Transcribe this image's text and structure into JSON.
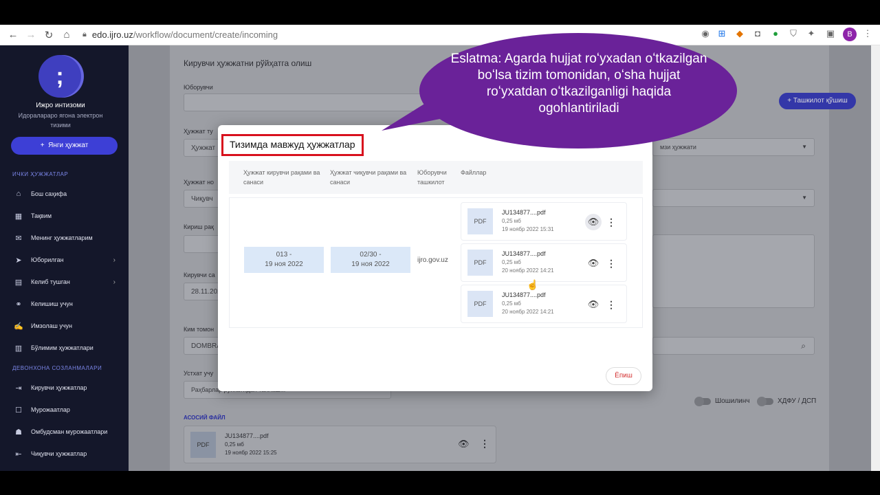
{
  "browser": {
    "url_host": "edo.ijro.uz",
    "url_path": "/workflow/document/create/incoming",
    "profile_initial": "B"
  },
  "sidebar": {
    "org_name": "Ижро интизоми",
    "org_subtitle": "Идоралараро ягона электрон тизими",
    "new_doc_button": "Янги ҳужжат",
    "section_internal": "ИЧКИ ҲУЖЖАТЛАР",
    "section_office": "ДЕВОНХОНА СОЗЛАНМАЛАРИ",
    "items": [
      {
        "label": "Бош саҳифа",
        "icon": "home-icon"
      },
      {
        "label": "Тақвим",
        "icon": "calendar-icon"
      },
      {
        "label": "Менинг ҳужжатларим",
        "icon": "documents-icon"
      },
      {
        "label": "Юборилган",
        "icon": "send-icon"
      },
      {
        "label": "Келиб тушган",
        "icon": "inbox-icon"
      },
      {
        "label": "Келишиш учун",
        "icon": "handshake-icon"
      },
      {
        "label": "Имзолаш учун",
        "icon": "signature-icon"
      },
      {
        "label": "Бўлимим ҳужжатлари",
        "icon": "department-docs-icon"
      },
      {
        "label": "Кирувчи ҳужжатлар",
        "icon": "incoming-icon"
      },
      {
        "label": "Мурожаатлар",
        "icon": "appeals-icon"
      },
      {
        "label": "Омбудсман мурожаатлари",
        "icon": "ombudsman-icon"
      },
      {
        "label": "Чиқувчи ҳужжатлар",
        "icon": "outgoing-icon"
      }
    ]
  },
  "form": {
    "title": "Кирувчи ҳужжатни рўйҳатга олиш",
    "sender_label": "Юборувчи",
    "doctype_label": "Ҳужжат ту",
    "doctype_placeholder": "Ҳужжат",
    "docnum_label": "Ҳужжат но",
    "docnum_value": "Чиқувч",
    "entry_label": "Кириш рақ",
    "incoming_label": "Кирувчи са",
    "incoming_value": "28.11.202",
    "who_label": "Ким томон",
    "who_value": "DOMBRA",
    "approver_label": "Устхат учу",
    "approver_placeholder": "Раҳбарлар рўйхатидан танлаш...",
    "add_org_button": "Ташкилот қўшиш",
    "right_select_value": "мзи ҳужжати",
    "urgent_label": "Шошилинч",
    "dsp_label": "ХДФУ / ДСП",
    "main_file_section": "АСОСИЙ ФАЙЛ",
    "main_file": {
      "name": "JU134877....pdf",
      "size": "0,25 мб",
      "date": "19 ноябр 2022 15:25",
      "type": "PDF"
    }
  },
  "modal": {
    "title": "Тизимда мавжуд ҳужжатлар",
    "columns": [
      "Ҳужжат кирувчи рақами ва санаси",
      "Ҳужжат чиқувчи рақами ва санаси",
      "Юборувчи ташкилот",
      "Файллар"
    ],
    "row": {
      "incoming": "013 -\n19 ноя 2022",
      "outgoing": "02/30 -\n19 ноя 2022",
      "sender": "ijro.gov.uz"
    },
    "files": [
      {
        "type": "PDF",
        "name": "JU134877....pdf",
        "size": "0,25 мб",
        "date": "19 ноябр 2022 15:31"
      },
      {
        "type": "PDF",
        "name": "JU134877....pdf",
        "size": "0,25 мб",
        "date": "20 ноябр 2022 14:21"
      },
      {
        "type": "PDF",
        "name": "JU134877....pdf",
        "size": "0,25 мб",
        "date": "20 ноябр 2022 14:21"
      }
    ],
    "close_button": "Ёпиш"
  },
  "callout": {
    "text": "Eslatma: Agarda hujjat roʻyxadan oʻtkazilgan boʻlsa tizim tomonidan, oʻsha hujjat roʻyxatdan oʻtkazilganligi haqida ogohlantiriladi"
  },
  "colors": {
    "sidebar_bg": "#14172a",
    "accent": "#3d3fd6",
    "callout": "#6a2299",
    "title_border": "#d8101d"
  }
}
